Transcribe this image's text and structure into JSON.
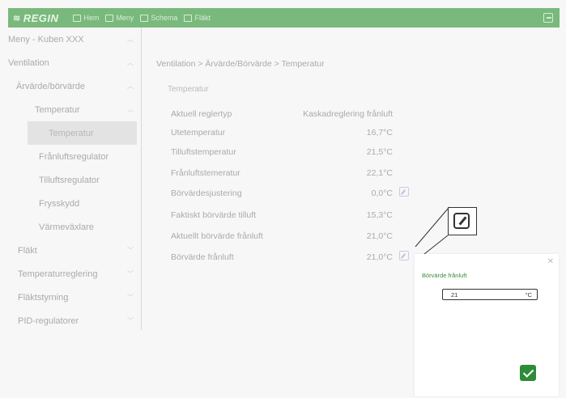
{
  "topbar": {
    "brand": "REGIN",
    "nav": [
      {
        "label": "Hem",
        "icon": "home-icon"
      },
      {
        "label": "Meny",
        "icon": "menu-icon"
      },
      {
        "label": "Schema",
        "icon": "calendar-icon"
      },
      {
        "label": "Fläkt",
        "icon": "fan-icon"
      }
    ],
    "exit_icon": "exit-icon",
    "color": "#7ab97c"
  },
  "sidebar": {
    "items": [
      {
        "label": "Meny - Kuben XXX",
        "chevron": "up",
        "depth": 0
      },
      {
        "label": "Ventilation",
        "chevron": "up",
        "depth": 1
      },
      {
        "label": "Ärvärde/börvärde",
        "chevron": "up",
        "depth": 2
      },
      {
        "label": "Temperatur",
        "chevron": "up",
        "depth": 3
      },
      {
        "label": "Temperatur",
        "chevron": "",
        "depth": 4,
        "selected": true
      },
      {
        "label": "Frånluftsregulator",
        "chevron": "",
        "depth": 5
      },
      {
        "label": "Tilluftsregulator",
        "chevron": "",
        "depth": 5
      },
      {
        "label": "Frysskydd",
        "chevron": "",
        "depth": 5
      },
      {
        "label": "Värmeväxlare",
        "chevron": "",
        "depth": 5
      },
      {
        "label": "Fläkt",
        "chevron": "down",
        "depth": 1
      },
      {
        "label": "Temperaturreglering",
        "chevron": "down",
        "depth": 1
      },
      {
        "label": "Fläktstyrning",
        "chevron": "down",
        "depth": 1
      },
      {
        "label": "PID-regulatorer",
        "chevron": "down",
        "depth": 1
      }
    ]
  },
  "main": {
    "breadcrumb": "Ventilation > Ärvärde/Börvärde > Temperatur",
    "section_title": "Temperatur",
    "rows": [
      {
        "key": "Aktuell reglertyp",
        "value": "Kaskadreglering frånluft",
        "editable": false
      },
      {
        "key": "Utetemperatur",
        "value": "16,7°C",
        "editable": false
      },
      {
        "key": "Tilluftstemperatur",
        "value": "21,5°C",
        "editable": false
      },
      {
        "key": "Frånluftstemeratur",
        "value": "22,1°C",
        "editable": false
      },
      {
        "key": "Börvärdesjustering",
        "value": "0,0°C",
        "editable": true
      },
      {
        "key": "Faktiskt börvärde tilluft",
        "value": "15,3°C",
        "editable": false
      },
      {
        "key": "Aktuellt börvärde frånluft",
        "value": "21,0°C",
        "editable": false
      },
      {
        "key": "Börvärde frånluft",
        "value": "21,0°C",
        "editable": true
      }
    ]
  },
  "popup": {
    "title": "Börvärde frånluft",
    "value": "21",
    "unit": "°C",
    "close_icon": "close-icon",
    "confirm_icon": "checkmark-icon",
    "confirm_color": "#2e8b3a"
  }
}
